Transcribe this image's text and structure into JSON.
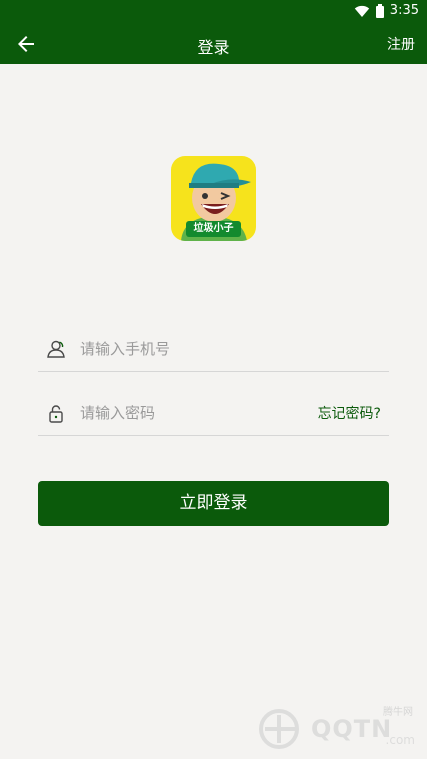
{
  "status_bar": {
    "time": "3:35"
  },
  "app_bar": {
    "title": "登录",
    "register_label": "注册"
  },
  "logo": {
    "text": "垃圾小子"
  },
  "form": {
    "phone_placeholder": "请输入手机号",
    "password_placeholder": "请输入密码",
    "forgot_label": "忘记密码?",
    "login_label": "立即登录"
  },
  "watermark": {
    "site_label": "腾牛网",
    "brand_text": "QQTN",
    "domain_suffix": ".com"
  },
  "colors": {
    "primary": "#0b5a0b",
    "background": "#f4f3f1",
    "logo_bg": "#f6e31c"
  },
  "icons": {
    "back": "arrow-left-icon",
    "user": "user-icon",
    "lock": "lock-icon",
    "wifi": "wifi-icon",
    "battery": "battery-icon"
  }
}
